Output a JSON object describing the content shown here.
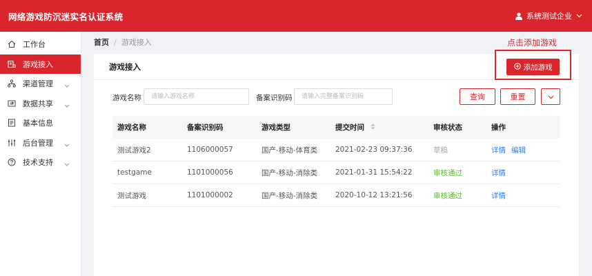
{
  "header": {
    "title": "网络游戏防沉迷实名认证系统",
    "user": "系统测试企业"
  },
  "sidebar": {
    "items": [
      {
        "label": "工作台",
        "icon": "home-icon",
        "active": false,
        "expandable": false
      },
      {
        "label": "游戏接入",
        "icon": "game-access-icon",
        "active": true,
        "expandable": false
      },
      {
        "label": "渠道管理",
        "icon": "channel-icon",
        "active": false,
        "expandable": true
      },
      {
        "label": "数据共享",
        "icon": "data-share-icon",
        "active": false,
        "expandable": true
      },
      {
        "label": "基本信息",
        "icon": "info-icon",
        "active": false,
        "expandable": false
      },
      {
        "label": "后台管理",
        "icon": "admin-icon",
        "active": false,
        "expandable": true
      },
      {
        "label": "技术支持",
        "icon": "support-icon",
        "active": false,
        "expandable": true
      }
    ]
  },
  "breadcrumb": {
    "home": "首页",
    "separator": "/",
    "current": "游戏接入"
  },
  "annotation": {
    "label": "点击添加游戏",
    "color": "#d9262c"
  },
  "card": {
    "title": "游戏接入",
    "add_button": "添加游戏"
  },
  "filter": {
    "name_label": "游戏名称",
    "name_placeholder": "请输入游戏名称",
    "code_label": "备案识别码",
    "code_placeholder": "请输入完整备案识别码",
    "query_button": "查询",
    "reset_button": "重置"
  },
  "table": {
    "headers": [
      "游戏名称",
      "备案识别码",
      "游戏类型",
      "提交时间",
      "审核状态",
      "操作"
    ],
    "rows": [
      {
        "name": "测试游戏2",
        "code": "1106000057",
        "type": "国产-移动-体育类",
        "time": "2021-02-23 09:37:36",
        "status": "草稿",
        "actions": [
          "详情",
          "编辑"
        ]
      },
      {
        "name": "testgame",
        "code": "1101000056",
        "type": "国产-移动-消除类",
        "time": "2021-01-31 15:54:22",
        "status": "审核通过",
        "actions": [
          "详情"
        ]
      },
      {
        "name": "测试游戏",
        "code": "1101000002",
        "type": "国产-移动-消除类",
        "time": "2020-10-12 13:21:56",
        "status": "审核通过",
        "actions": [
          "详情"
        ]
      }
    ]
  },
  "colors": {
    "brand": "#d9262c",
    "success": "#52c41a",
    "link": "#2d7ff9",
    "draft": "#aaaaaa"
  }
}
